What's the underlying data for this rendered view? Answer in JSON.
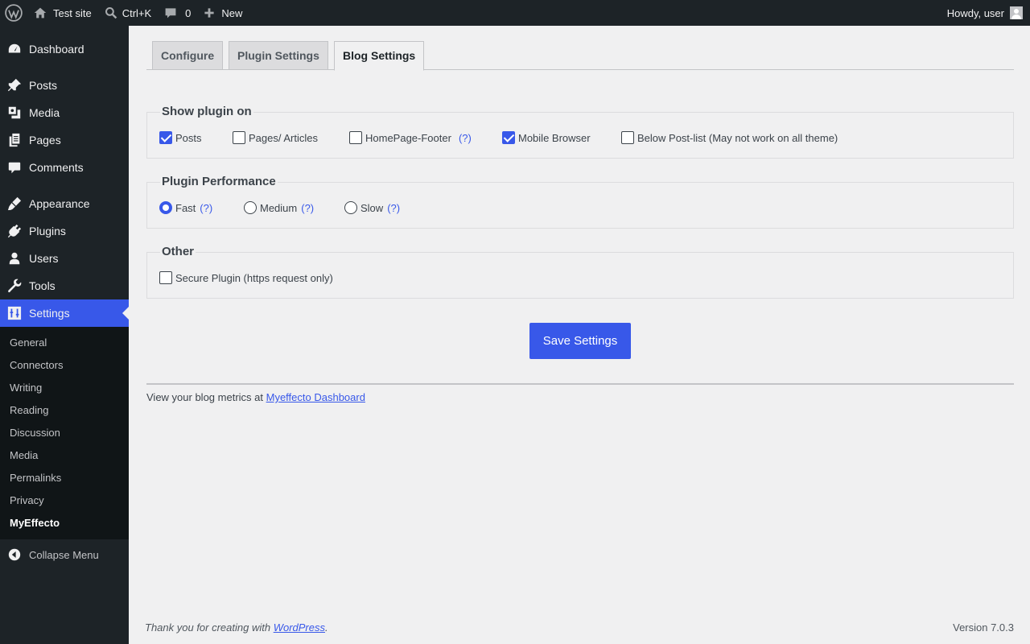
{
  "adminbar": {
    "site_name": "Test site",
    "search_shortcut": "Ctrl+K",
    "comments_count": "0",
    "new_label": "New",
    "howdy": "Howdy, user"
  },
  "sidebar": {
    "items": [
      {
        "label": "Dashboard",
        "icon": "dashboard-icon"
      },
      {
        "label": "Posts",
        "icon": "pin-icon"
      },
      {
        "label": "Media",
        "icon": "media-icon"
      },
      {
        "label": "Pages",
        "icon": "pages-icon"
      },
      {
        "label": "Comments",
        "icon": "comment-icon"
      },
      {
        "label": "Appearance",
        "icon": "brush-icon"
      },
      {
        "label": "Plugins",
        "icon": "plug-icon"
      },
      {
        "label": "Users",
        "icon": "user-icon"
      },
      {
        "label": "Tools",
        "icon": "wrench-icon"
      },
      {
        "label": "Settings",
        "icon": "settings-icon"
      }
    ],
    "submenu": [
      "General",
      "Connectors",
      "Writing",
      "Reading",
      "Discussion",
      "Media",
      "Permalinks",
      "Privacy",
      "MyEffecto"
    ],
    "collapse_label": "Collapse Menu"
  },
  "tabs": [
    "Configure",
    "Plugin Settings",
    "Blog Settings"
  ],
  "show_plugin_on": {
    "legend": "Show plugin on",
    "options": [
      {
        "label": "Posts",
        "checked": true
      },
      {
        "label": "Pages/ Articles",
        "checked": false
      },
      {
        "label": "HomePage-Footer",
        "checked": false,
        "help": "(?)"
      },
      {
        "label": "Mobile Browser",
        "checked": true
      },
      {
        "label": "Below Post-list (May not work on all theme)",
        "checked": false
      }
    ]
  },
  "performance": {
    "legend": "Plugin Performance",
    "options": [
      {
        "label": "Fast",
        "help": "(?)",
        "selected": true
      },
      {
        "label": "Medium",
        "help": "(?)",
        "selected": false
      },
      {
        "label": "Slow",
        "help": "(?)",
        "selected": false
      }
    ]
  },
  "other": {
    "legend": "Other",
    "options": [
      {
        "label": "Secure Plugin (https request only)",
        "checked": false
      }
    ]
  },
  "save_label": "Save Settings",
  "metrics": {
    "prefix": "View your blog metrics at ",
    "link": "Myeffecto Dashboard"
  },
  "footer": {
    "thanks_prefix": "Thank you for creating with ",
    "thanks_link": "WordPress",
    "thanks_suffix": ".",
    "version": "Version 7.0.3"
  },
  "colors": {
    "accent": "#3858e9",
    "adminbar_bg": "#1d2327",
    "content_bg": "#f0f0f1"
  }
}
